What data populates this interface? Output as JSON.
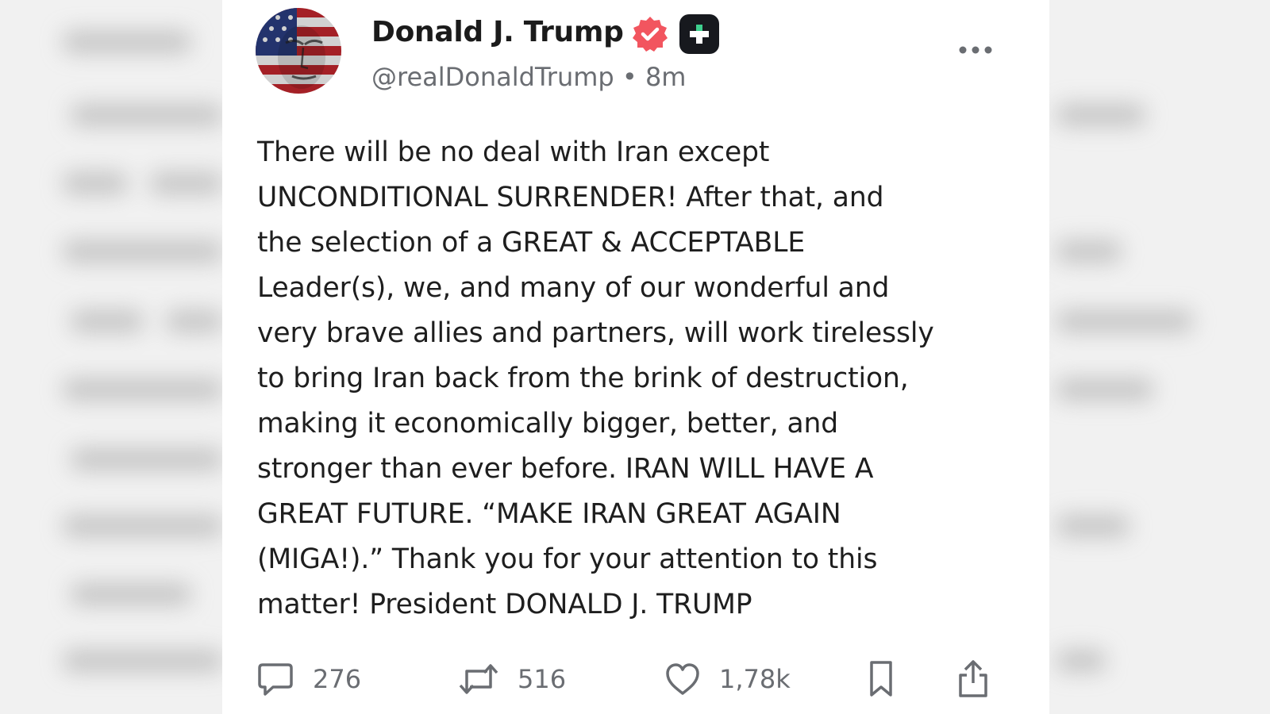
{
  "post": {
    "author": {
      "display_name": "Donald J. Trump",
      "handle": "@realDonaldTrump",
      "time_ago": "8m",
      "handle_line": "@realDonaldTrump • 8m"
    },
    "text": "There will be no deal with Iran except\nUNCONDITIONAL SURRENDER! After that, and\nthe selection of a GREAT & ACCEPTABLE\nLeader(s), we, and many of our wonderful and\nvery brave allies and partners, will work tirelessly\nto bring Iran back from the brink of destruction,\nmaking it economically bigger, better, and\nstronger than ever before. IRAN WILL HAVE A\nGREAT FUTURE. “MAKE IRAN GREAT AGAIN\n(MIGA!).” Thank you for your attention to this\nmatter! President DONALD J. TRUMP",
    "actions": {
      "replies": "276",
      "reposts": "516",
      "likes": "1,78k"
    }
  },
  "icons": {
    "verified": "verified-badge-icon",
    "plus": "plus-badge-icon",
    "more": "more-options-icon",
    "reply": "reply-icon",
    "repost": "repost-icon",
    "like": "heart-icon",
    "bookmark": "bookmark-icon",
    "share": "share-icon"
  },
  "colors": {
    "verified": "#f2555f",
    "plus_badge_bg": "#17191e",
    "plus_cross": "#3ecf8e",
    "text": "#1e1e1e",
    "muted": "#6a6d72"
  }
}
